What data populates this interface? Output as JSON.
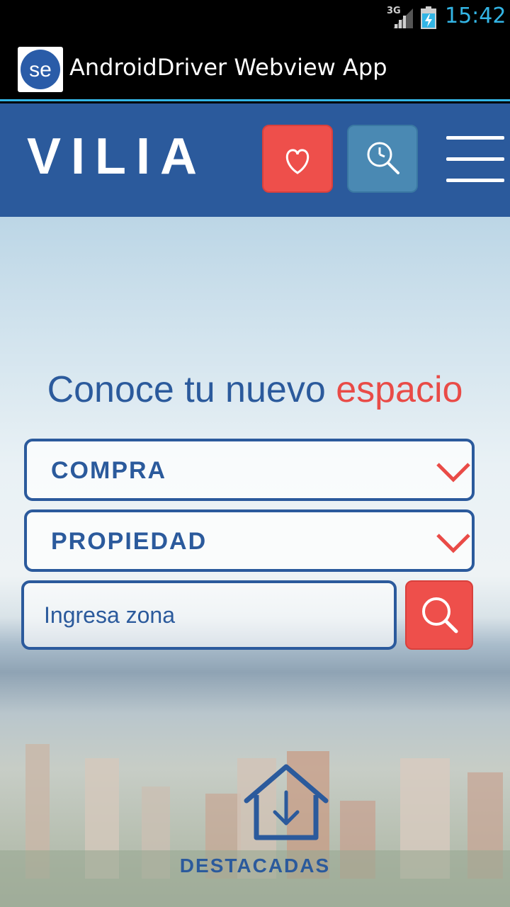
{
  "status_bar": {
    "network": "3G",
    "time": "15:42",
    "icons": [
      "signal-icon",
      "battery-charging-icon"
    ]
  },
  "app_bar": {
    "title": "AndroidDriver Webview App",
    "logo_text": "se"
  },
  "header": {
    "brand": "VILIA",
    "favorites_icon": "heart-icon",
    "history_icon": "clock-search-icon",
    "menu_icon": "hamburger-menu-icon"
  },
  "hero": {
    "tagline_main": "Conoce tu nuevo ",
    "tagline_accent": "espacio",
    "operation_select": {
      "selected": "COMPRA"
    },
    "property_select": {
      "selected": "PROPIEDAD"
    },
    "zone_input": {
      "value": "",
      "placeholder": "Ingresa zona"
    },
    "search_icon": "search-icon"
  },
  "featured": {
    "icon": "house-download-icon",
    "label": "DESTACADAS"
  },
  "colors": {
    "brand_blue": "#2b5a9c",
    "accent_red": "#ee4f4b",
    "history_blue": "#4a89b3",
    "android_blue": "#33b5e5"
  }
}
